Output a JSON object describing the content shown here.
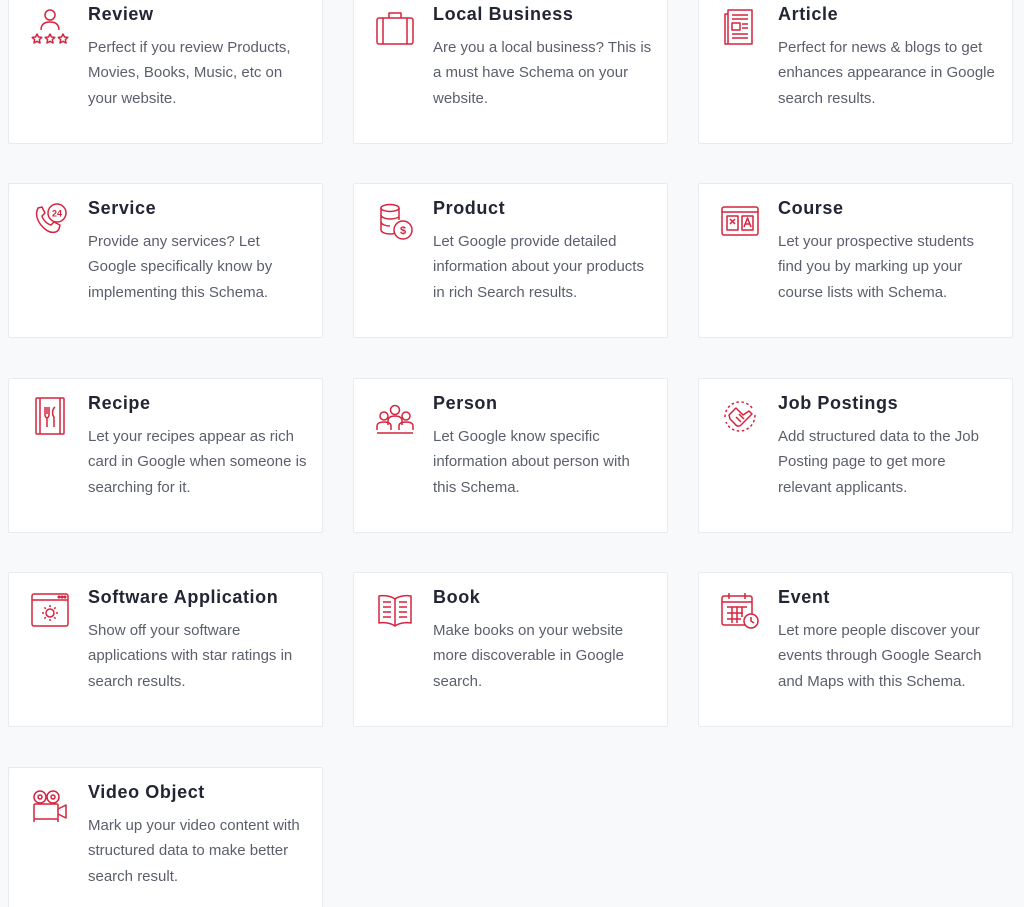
{
  "accent_color": "#d6243f",
  "cards": [
    {
      "icon": "review-icon",
      "title": "Review",
      "desc": "Perfect if you review Products, Movies, Books, Music, etc on your website."
    },
    {
      "icon": "local-business-icon",
      "title": "Local Business",
      "desc": "Are you a local business? This is a must have Schema on your website."
    },
    {
      "icon": "article-icon",
      "title": "Article",
      "desc": "Perfect for news & blogs to get enhances appearance in Google search results."
    },
    {
      "icon": "service-icon",
      "title": "Service",
      "desc": "Provide any services? Let Google specifically know by implementing this Schema."
    },
    {
      "icon": "product-icon",
      "title": "Product",
      "desc": "Let Google provide detailed information about your products in rich Search results."
    },
    {
      "icon": "course-icon",
      "title": "Course",
      "desc": "Let your prospective students find you by marking up your course lists with Schema."
    },
    {
      "icon": "recipe-icon",
      "title": "Recipe",
      "desc": "Let your recipes appear as rich card in Google when someone is searching for it."
    },
    {
      "icon": "person-icon",
      "title": "Person",
      "desc": "Let Google know specific information about person with this Schema."
    },
    {
      "icon": "job-postings-icon",
      "title": "Job Postings",
      "desc": "Add structured data to the Job Posting page to get more relevant applicants."
    },
    {
      "icon": "software-application-icon",
      "title": "Software Application",
      "desc": "Show off your software applications with star ratings in search results."
    },
    {
      "icon": "book-icon",
      "title": "Book",
      "desc": "Make books on your website more discoverable in Google search."
    },
    {
      "icon": "event-icon",
      "title": "Event",
      "desc": "Let more people discover your events through Google Search and Maps with this Schema."
    },
    {
      "icon": "video-object-icon",
      "title": "Video Object",
      "desc": "Mark up your video content with structured data to make better search result."
    }
  ]
}
